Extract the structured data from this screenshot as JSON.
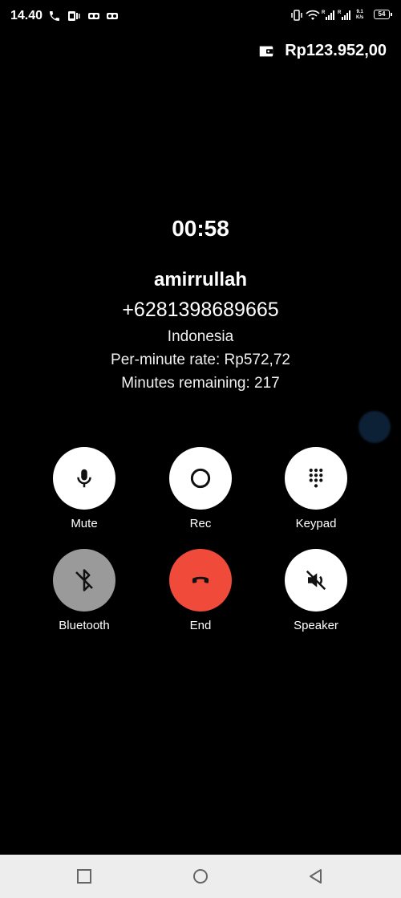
{
  "status_bar": {
    "time": "14.40",
    "net_speed_top": "9.1",
    "net_speed_bottom": "K/s",
    "battery_level": "54"
  },
  "balance": {
    "amount": "Rp123.952,00"
  },
  "call": {
    "timer": "00:58",
    "name": "amirrullah",
    "number": "+6281398689665",
    "country": "Indonesia",
    "rate": "Per-minute rate: Rp572,72",
    "remaining": "Minutes remaining: 217"
  },
  "controls": {
    "mute": "Mute",
    "rec": "Rec",
    "keypad": "Keypad",
    "bluetooth": "Bluetooth",
    "end": "End",
    "speaker": "Speaker"
  },
  "colors": {
    "end_button": "#f04a3a",
    "bluetooth_button": "#9a9a9a",
    "control_bg": "#ffffff",
    "nav_bar": "#ededed"
  }
}
